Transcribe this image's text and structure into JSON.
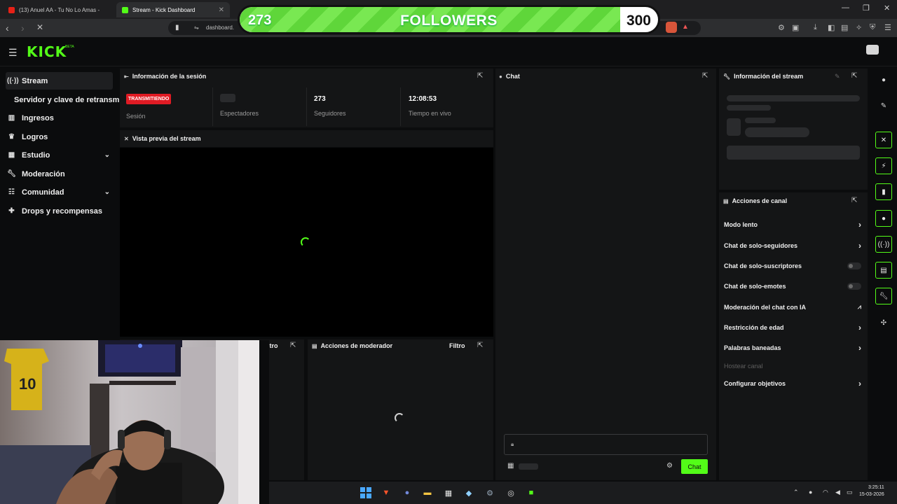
{
  "browser": {
    "tabs": [
      {
        "title": "(13) Anuel AA - Tu No Lo Amas -"
      },
      {
        "title": "Stream - Kick Dashboard"
      }
    ],
    "url": "dashboard."
  },
  "overlay": {
    "current": "273",
    "label": "FOLLOWERS",
    "target": "300",
    "progress": 0.91
  },
  "brand": {
    "logo": "KICK",
    "badge": "BETA",
    "accent": "#53fc18"
  },
  "sidebar": {
    "items": [
      {
        "label": "Stream",
        "icon": "broadcast-icon",
        "active": true
      },
      {
        "label": "Servidor y clave de retransmi",
        "sub": true
      },
      {
        "label": "Ingresos",
        "icon": "bar-chart-icon"
      },
      {
        "label": "Logros",
        "icon": "trophy-icon"
      },
      {
        "label": "Estudio",
        "icon": "studio-icon",
        "expandable": true
      },
      {
        "label": "Moderación",
        "icon": "wrench-icon"
      },
      {
        "label": "Comunidad",
        "icon": "community-icon",
        "expandable": true
      },
      {
        "label": "Drops y recompensas",
        "icon": "gift-icon"
      }
    ]
  },
  "session": {
    "title": "Información de la sesión",
    "status": "TRANSMITIENDO",
    "status_label": "Sesión",
    "viewers_label": "Espectadores",
    "followers_value": "273",
    "followers_label": "Seguidores",
    "live_time_value": "12:08:53",
    "live_time_label": "Tiempo en vivo"
  },
  "preview": {
    "title": "Vista previa del stream"
  },
  "partial_panel": {
    "filter": "ltro"
  },
  "moderator": {
    "title": "Acciones de moderador",
    "filter": "Filtro"
  },
  "chat": {
    "title": "Chat",
    "send_label": "Chat"
  },
  "stream_info": {
    "title": "Información del stream"
  },
  "channel_actions": {
    "title": "Acciones de canal",
    "items": [
      {
        "label": "Modo lento",
        "control": "arrow"
      },
      {
        "label": "Chat de solo-seguidores",
        "control": "arrow"
      },
      {
        "label": "Chat de solo-suscriptores",
        "control": "toggle"
      },
      {
        "label": "Chat de solo-emotes",
        "control": "toggle"
      },
      {
        "label": "Moderación del chat con IA",
        "control": "chart"
      },
      {
        "label": "Restricción de edad",
        "control": "arrow"
      },
      {
        "label": "Palabras baneadas",
        "control": "arrow"
      },
      {
        "label": "Hostear canal",
        "control": "disabled"
      },
      {
        "label": "Configurar objetivos",
        "control": "arrow"
      }
    ]
  },
  "taskbar": {
    "time": "3:25:11",
    "date": "15-03-2026"
  }
}
